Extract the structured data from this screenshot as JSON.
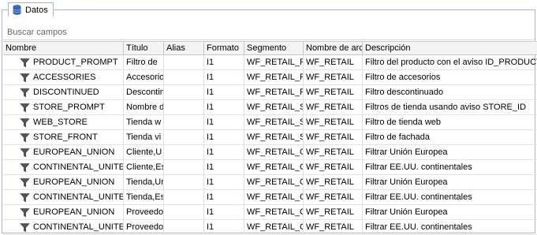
{
  "tab": {
    "label": "Datos",
    "icon": "database-icon"
  },
  "search": {
    "placeholder": "Buscar campos"
  },
  "columns": [
    "Nombre",
    "Título",
    "Alias",
    "Formato",
    "Segmento",
    "Nombre de arc",
    "Descripción"
  ],
  "rows": [
    {
      "icon": "filter-icon",
      "nombre": "PRODUCT_PROMPT",
      "titulo": "Filtro de",
      "alias": "",
      "formato": "I1",
      "segmento": "WF_RETAIL_P",
      "archivo": "WF_RETAIL",
      "descripcion": "Filtro del producto con el aviso ID_PRODUCT"
    },
    {
      "icon": "filter-icon",
      "nombre": "ACCESSORIES",
      "titulo": "Accesorio",
      "alias": "",
      "formato": "I1",
      "segmento": "WF_RETAIL_P",
      "archivo": "WF_RETAIL",
      "descripcion": "Filtro de accesorios"
    },
    {
      "icon": "filter-icon",
      "nombre": "DISCONTINUED",
      "titulo": "Descontin",
      "alias": "",
      "formato": "I1",
      "segmento": "WF_RETAIL_P",
      "archivo": "WF_RETAIL",
      "descripcion": "Filtro descontinuado"
    },
    {
      "icon": "filter-icon",
      "nombre": "STORE_PROMPT",
      "titulo": "Nombre d",
      "alias": "",
      "formato": "I1",
      "segmento": "WF_RETAIL_S",
      "archivo": "WF_RETAIL",
      "descripcion": "Filtros de tienda usando aviso STORE_ID"
    },
    {
      "icon": "filter-icon",
      "nombre": "WEB_STORE",
      "titulo": "Tienda w",
      "alias": "",
      "formato": "I1",
      "segmento": "WF_RETAIL_S",
      "archivo": "WF_RETAIL",
      "descripcion": "Filtro de tienda web"
    },
    {
      "icon": "filter-icon",
      "nombre": "STORE_FRONT",
      "titulo": "Tienda vi",
      "alias": "",
      "formato": "I1",
      "segmento": "WF_RETAIL_S",
      "archivo": "WF_RETAIL",
      "descripcion": "Filtro de fachada"
    },
    {
      "icon": "filter-icon",
      "nombre": "EUROPEAN_UNION",
      "titulo": "Cliente,U",
      "alias": "",
      "formato": "I1",
      "segmento": "WF_RETAIL_G",
      "archivo": "WF_RETAIL",
      "descripcion": "Filtrar Unión Europea"
    },
    {
      "icon": "filter-icon",
      "nombre": "CONTINENTAL_UNITE",
      "titulo": "Cliente,Es",
      "alias": "",
      "formato": "I1",
      "segmento": "WF_RETAIL_G",
      "archivo": "WF_RETAIL",
      "descripcion": "Filtrar EE.UU. continentales"
    },
    {
      "icon": "filter-icon",
      "nombre": "EUROPEAN_UNION",
      "titulo": "Tienda,Ur",
      "alias": "",
      "formato": "I1",
      "segmento": "WF_RETAIL_G",
      "archivo": "WF_RETAIL",
      "descripcion": "Filtrar Unión Europea"
    },
    {
      "icon": "filter-icon",
      "nombre": "CONTINENTAL_UNITE",
      "titulo": "Tienda,Es",
      "alias": "",
      "formato": "I1",
      "segmento": "WF_RETAIL_G",
      "archivo": "WF_RETAIL",
      "descripcion": "Filtrar EE.UU. continentales"
    },
    {
      "icon": "filter-icon",
      "nombre": "EUROPEAN_UNION",
      "titulo": "Proveedo",
      "alias": "",
      "formato": "I1",
      "segmento": "WF_RETAIL_G",
      "archivo": "WF_RETAIL",
      "descripcion": "Filtrar Unión Europea"
    },
    {
      "icon": "filter-icon",
      "nombre": "CONTINENTAL_UNITE",
      "titulo": "Proveedo",
      "alias": "",
      "formato": "I1",
      "segmento": "WF_RETAIL_G",
      "archivo": "WF_RETAIL",
      "descripcion": "Filtrar EE.UU. continentales"
    }
  ]
}
